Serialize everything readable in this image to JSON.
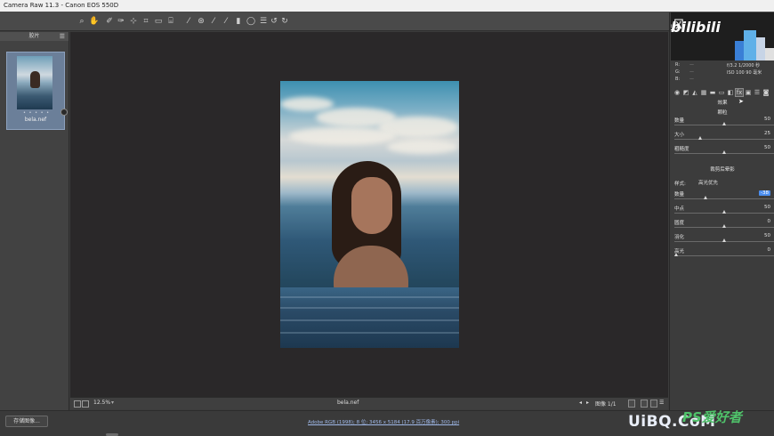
{
  "window": {
    "title": "Camera Raw 11.3 -  Canon EOS 550D"
  },
  "toolbar": {
    "tools": [
      {
        "name": "zoom-tool-icon",
        "glyph": "⌕"
      },
      {
        "name": "hand-tool-icon",
        "glyph": "✋"
      },
      {
        "name": "white-balance-tool-icon",
        "glyph": "✐"
      },
      {
        "name": "color-sampler-tool-icon",
        "glyph": "✑"
      },
      {
        "name": "targeted-adjustment-tool-icon",
        "glyph": "⊹"
      },
      {
        "name": "crop-tool-icon",
        "glyph": "⌗"
      },
      {
        "name": "straighten-tool-icon",
        "glyph": "▭"
      },
      {
        "name": "transform-tool-icon",
        "glyph": "⌸"
      },
      {
        "name": "spot-removal-tool-icon",
        "glyph": "⁄"
      },
      {
        "name": "red-eye-tool-icon",
        "glyph": "⊛"
      },
      {
        "name": "adjustment-brush-icon",
        "glyph": "⁄"
      },
      {
        "name": "graduated-filter-icon",
        "glyph": "⁄"
      },
      {
        "name": "radial-filter-icon",
        "glyph": "▮"
      },
      {
        "name": "range-mask-icon",
        "glyph": "◯"
      },
      {
        "name": "preferences-icon",
        "glyph": "☰"
      },
      {
        "name": "rotate-left-icon",
        "glyph": "↺"
      },
      {
        "name": "rotate-right-icon",
        "glyph": "↻"
      }
    ]
  },
  "filmstrip": {
    "header": "胶片",
    "items": [
      {
        "filename": "bela.nef",
        "stars": "• • • • •"
      }
    ]
  },
  "canvas": {
    "filename": "bela.nef",
    "zoom": "12.5%"
  },
  "statusbar": {
    "page": "图像 1/1"
  },
  "bottom": {
    "save_label": "存储图像...",
    "workflow": "Adobe RGB (1998); 8 位; 3456 x 5184 (17.9 百万像素); 300 ppi"
  },
  "watermarks": {
    "top_right_text": "八月墨风",
    "top_right_logo": "bilibili",
    "bottom_right": "UiBQ.CoM",
    "bottom_right_cn": "PS爱好者"
  },
  "camera_info": {
    "rows": [
      {
        "label": "R:",
        "value": "f/3.2   1/2000 秒"
      },
      {
        "label": "G:",
        "value": "ISO 100   90 毫米"
      },
      {
        "label": "B:",
        "value": ""
      }
    ]
  },
  "right_panel": {
    "panel_title": "效果",
    "grain_title": "颗粒",
    "grain": [
      {
        "label": "数量",
        "value": "50",
        "fraction": 0.5
      },
      {
        "label": "大小",
        "value": "25",
        "fraction": 0.25
      },
      {
        "label": "粗糙度",
        "value": "50",
        "fraction": 0.5
      }
    ],
    "vignette_title": "裁剪后晕影",
    "style_label": "样式:",
    "style_value": "高光优先",
    "vignette": [
      {
        "label": "数量",
        "value": "-38",
        "fraction": 0.31,
        "highlight": true
      },
      {
        "label": "中点",
        "value": "50",
        "fraction": 0.5
      },
      {
        "label": "圆度",
        "value": "0",
        "fraction": 0.5
      },
      {
        "label": "羽化",
        "value": "50",
        "fraction": 0.5
      },
      {
        "label": "高光",
        "value": "0",
        "fraction": 0.0
      }
    ]
  },
  "colors": {
    "accent": "#4b8ef0",
    "canvas_bg": "#2a2829",
    "panel_bg": "#3c3c3c"
  }
}
